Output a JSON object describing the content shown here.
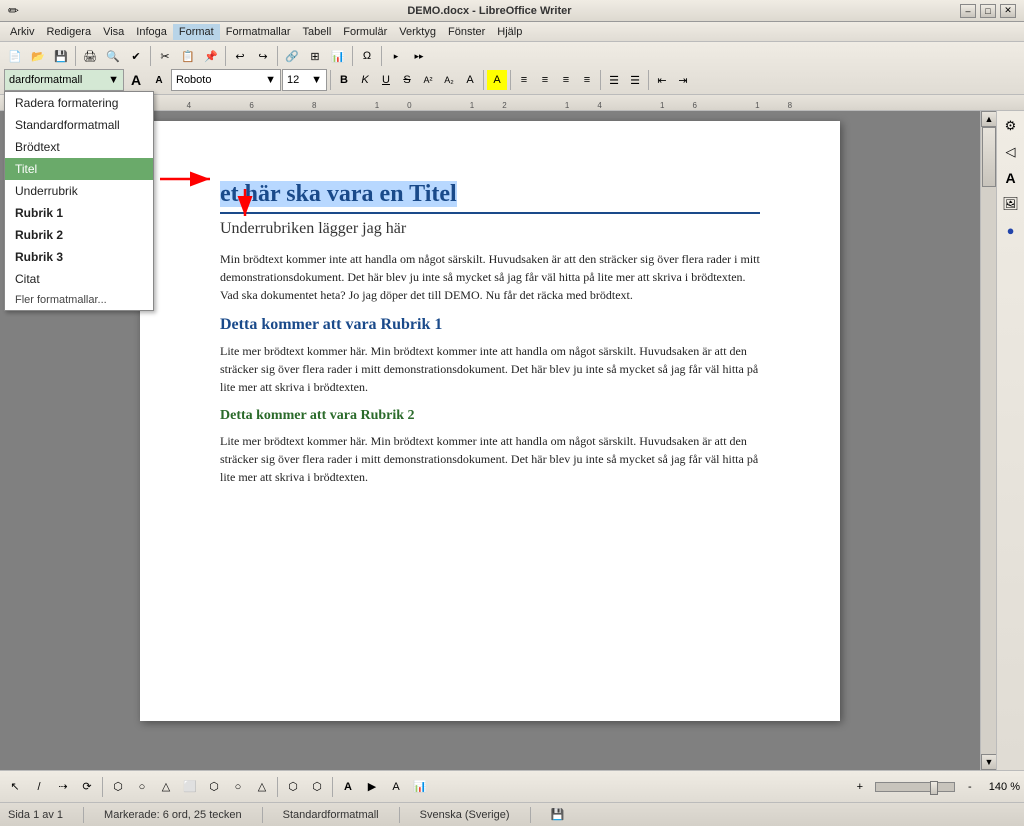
{
  "window": {
    "title": "DEMO.docx - LibreOffice Writer",
    "min_label": "–",
    "max_label": "□",
    "close_label": "✕"
  },
  "menubar": {
    "items": [
      "Arkiv",
      "Redigera",
      "Visa",
      "Infoga",
      "Format",
      "Formatmallar",
      "Tabell",
      "Formulär",
      "Verktyg",
      "Fönster",
      "Hjälp"
    ]
  },
  "toolbar": {
    "style_dropdown": "dardformatmall",
    "font_name": "Roboto",
    "font_size": "12"
  },
  "format_dropdown": {
    "visible": true,
    "items": [
      {
        "id": "radera",
        "label": "Radera formatering",
        "style": "normal"
      },
      {
        "id": "standard",
        "label": "Standardformatmall",
        "style": "normal"
      },
      {
        "id": "brodtext",
        "label": "Brödtext",
        "style": "normal"
      },
      {
        "id": "titel",
        "label": "Titel",
        "style": "active"
      },
      {
        "id": "underrubrik",
        "label": "Underrubrik",
        "style": "normal"
      },
      {
        "id": "rubrik1",
        "label": "Rubrik 1",
        "style": "bold"
      },
      {
        "id": "rubrik2",
        "label": "Rubrik 2",
        "style": "bold"
      },
      {
        "id": "rubrik3",
        "label": "Rubrik 3",
        "style": "bold"
      },
      {
        "id": "citat",
        "label": "Citat",
        "style": "normal"
      },
      {
        "id": "fler",
        "label": "Fler formatmallar...",
        "style": "more"
      }
    ]
  },
  "document": {
    "title_text": "et här ska vara en Titel",
    "subtitle_text": "Underrubriken lägger jag här",
    "body1": "Min brödtext kommer inte att handla om något särskilt. Huvudsaken är att den sträcker sig över flera rader i mitt demonstrationsdokument. Det här blev ju inte så mycket så jag får väl hitta på lite mer att skriva i brödtexten. Vad ska dokumentet heta? Jo jag döper det till DEMO. Nu får det räcka med brödtext.",
    "h1": "Detta kommer att vara Rubrik 1",
    "body2": "Lite mer brödtext kommer här. Min brödtext kommer inte att handla om något särskilt. Huvudsaken är att den sträcker sig över flera rader i mitt demonstrationsdokument. Det här blev ju inte så mycket så jag får väl hitta på lite mer att skriva i brödtexten.",
    "h2": "Detta kommer att vara Rubrik 2",
    "body3": "Lite mer brödtext kommer här. Min brödtext kommer inte att handla om något särskilt. Huvudsaken är att den sträcker sig över flera rader i mitt demonstrationsdokument. Det här blev ju inte så mycket så jag får väl hitta på lite mer att skriva i brödtexten."
  },
  "statusbar": {
    "page_info": "Sida 1 av 1",
    "selection": "Markerade: 6 ord, 25 tecken",
    "style": "Standardformatmall",
    "language": "Svenska (Sverige)",
    "zoom": "140 %"
  },
  "sidebar": {
    "icons": [
      "⚙",
      "📌",
      "A",
      "🖼",
      "🔵"
    ]
  },
  "bottom_toolbar": {
    "items": [
      "↖",
      "/",
      "⇢",
      "⟳",
      "⬡",
      "○",
      "△",
      "⬜",
      "⬡",
      "○",
      "△",
      "⬡",
      "⬡",
      "A",
      "▶",
      "A",
      "📊"
    ]
  }
}
